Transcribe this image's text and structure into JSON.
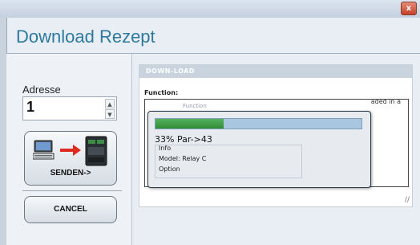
{
  "window": {
    "close_glyph": "x",
    "title": "Download Rezept"
  },
  "address": {
    "label": "Adresse",
    "value": "1",
    "spin_up": "▲",
    "spin_down": "▼"
  },
  "buttons": {
    "send_label": "SENDEN->",
    "cancel_label": "CANCEL"
  },
  "content": {
    "header": "DOWN-LOAD",
    "function_label": "Function:",
    "background_text": "aded in a",
    "faded_tab": "Function",
    "resize_glyph": "//"
  },
  "progress": {
    "percent": 33,
    "text": "33% Par->43",
    "info_label": "Info",
    "model_line": "Model: Relay C",
    "option_label": "Option"
  },
  "icons": [
    "computer-icon",
    "arrow-right-icon",
    "relay-device-icon",
    "resize-grip-icon"
  ],
  "colors": {
    "title": "#2d7a9e",
    "progress_fill": "#3a9a42",
    "arrow": "#e02a1f"
  }
}
